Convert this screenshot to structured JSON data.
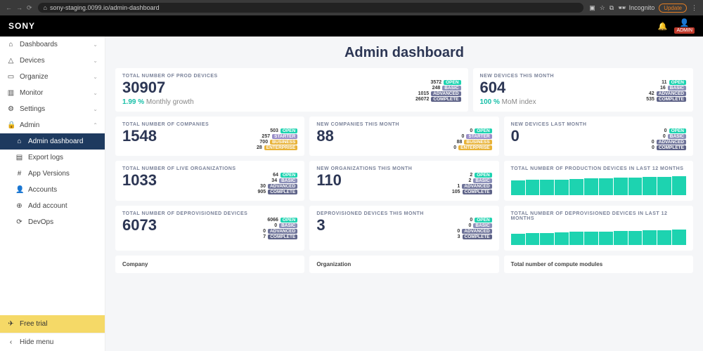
{
  "browser": {
    "url": "sony-staging.0099.io/admin-dashboard",
    "incognito": "Incognito",
    "update": "Update"
  },
  "brand": "SONY",
  "admin_label": "ADMIN",
  "sidebar": {
    "items": [
      {
        "icon": "⌂",
        "label": "Dashboards",
        "exp": true
      },
      {
        "icon": "△",
        "label": "Devices",
        "exp": true
      },
      {
        "icon": "▭",
        "label": "Organize",
        "exp": true
      },
      {
        "icon": "▥",
        "label": "Monitor",
        "exp": true
      },
      {
        "icon": "⚙",
        "label": "Settings",
        "exp": true
      },
      {
        "icon": "🔒",
        "label": "Admin",
        "exp": true,
        "open": true
      }
    ],
    "sub": [
      {
        "icon": "⌂",
        "label": "Admin dashboard",
        "active": true
      },
      {
        "icon": "▤",
        "label": "Export logs"
      },
      {
        "icon": "#",
        "label": "App Versions"
      },
      {
        "icon": "👤",
        "label": "Accounts"
      },
      {
        "icon": "⊕",
        "label": "Add account"
      },
      {
        "icon": "⟳",
        "label": "DevOps"
      }
    ],
    "free_trial": "Free trial",
    "hide": "Hide menu"
  },
  "title": "Admin dashboard",
  "cards": {
    "prod_devices": {
      "title": "TOTAL NUMBER OF PROD DEVICES",
      "value": "30907",
      "pct": "1.99 %",
      "pct_label": "Monthly growth",
      "tags": [
        [
          "3572",
          "OPEN"
        ],
        [
          "248",
          "BASIC"
        ],
        [
          "1015",
          "ADVANCED"
        ],
        [
          "26072",
          "COMPLETE"
        ]
      ]
    },
    "new_devices": {
      "title": "NEW DEVICES THIS MONTH",
      "value": "604",
      "pct": "100 %",
      "pct_label": "MoM index",
      "tags": [
        [
          "11",
          "OPEN"
        ],
        [
          "16",
          "BASIC"
        ],
        [
          "42",
          "ADVANCED"
        ],
        [
          "535",
          "COMPLETE"
        ]
      ]
    },
    "companies": {
      "title": "TOTAL NUMBER OF COMPANIES",
      "value": "1548",
      "tags": [
        [
          "503",
          "OPEN"
        ],
        [
          "257",
          "STARTER"
        ],
        [
          "700",
          "BUSINESS"
        ],
        [
          "28",
          "ENTERPRISE"
        ]
      ]
    },
    "new_companies": {
      "title": "NEW COMPANIES THIS MONTH",
      "value": "88",
      "tags": [
        [
          "0",
          "OPEN"
        ],
        [
          "0",
          "STARTER"
        ],
        [
          "88",
          "BUSINESS"
        ],
        [
          "0",
          "ENTERPRISE"
        ]
      ]
    },
    "new_devices_last": {
      "title": "NEW DEVICES LAST MONTH",
      "value": "0",
      "tags": [
        [
          "0",
          "OPEN"
        ],
        [
          "0",
          "BASIC"
        ],
        [
          "0",
          "ADVANCED"
        ],
        [
          "0",
          "COMPLETE"
        ]
      ]
    },
    "live_orgs": {
      "title": "TOTAL NUMBER OF LIVE ORGANIZATIONS",
      "value": "1033",
      "tags": [
        [
          "64",
          "OPEN"
        ],
        [
          "34",
          "BASIC"
        ],
        [
          "30",
          "ADVANCED"
        ],
        [
          "905",
          "COMPLETE"
        ]
      ]
    },
    "new_orgs": {
      "title": "NEW ORGANIZATIONS THIS MONTH",
      "value": "110",
      "tags": [
        [
          "2",
          "OPEN"
        ],
        [
          "2",
          "BASIC"
        ],
        [
          "1",
          "ADVANCED"
        ],
        [
          "105",
          "COMPLETE"
        ]
      ]
    },
    "prod_12m": {
      "title": "TOTAL NUMBER OF PRODUCTION DEVICES IN LAST 12 MONTHS"
    },
    "deprov": {
      "title": "TOTAL NUMBER OF DEPROVISIONED DEVICES",
      "value": "6073",
      "tags": [
        [
          "6066",
          "OPEN"
        ],
        [
          "0",
          "BASIC"
        ],
        [
          "0",
          "ADVANCED"
        ],
        [
          "7",
          "COMPLETE"
        ]
      ]
    },
    "deprov_month": {
      "title": "DEPROVISIONED DEVICES THIS MONTH",
      "value": "3",
      "tags": [
        [
          "0",
          "OPEN"
        ],
        [
          "0",
          "BASIC"
        ],
        [
          "0",
          "ADVANCED"
        ],
        [
          "3",
          "COMPLETE"
        ]
      ]
    },
    "deprov_12m": {
      "title": "TOTAL NUMBER OF DEPROVISIONED DEVICES IN LAST 12 MONTHS"
    }
  },
  "bottom": {
    "company": "Company",
    "organization": "Organization",
    "compute": "Total number of compute modules"
  },
  "chart_data": [
    {
      "type": "bar",
      "title": "Production devices 12m",
      "values": [
        70,
        72,
        74,
        75,
        77,
        79,
        80,
        82,
        84,
        86,
        88,
        90
      ]
    },
    {
      "type": "bar",
      "title": "Deprovisioned devices 12m",
      "values": [
        55,
        58,
        56,
        60,
        62,
        63,
        65,
        66,
        68,
        70,
        71,
        72
      ]
    }
  ],
  "tag_classes": {
    "OPEN": "open",
    "BASIC": "basic",
    "ADVANCED": "advanced",
    "COMPLETE": "complete",
    "STARTER": "starter",
    "BUSINESS": "business",
    "ENTERPRISE": "enterprise"
  }
}
